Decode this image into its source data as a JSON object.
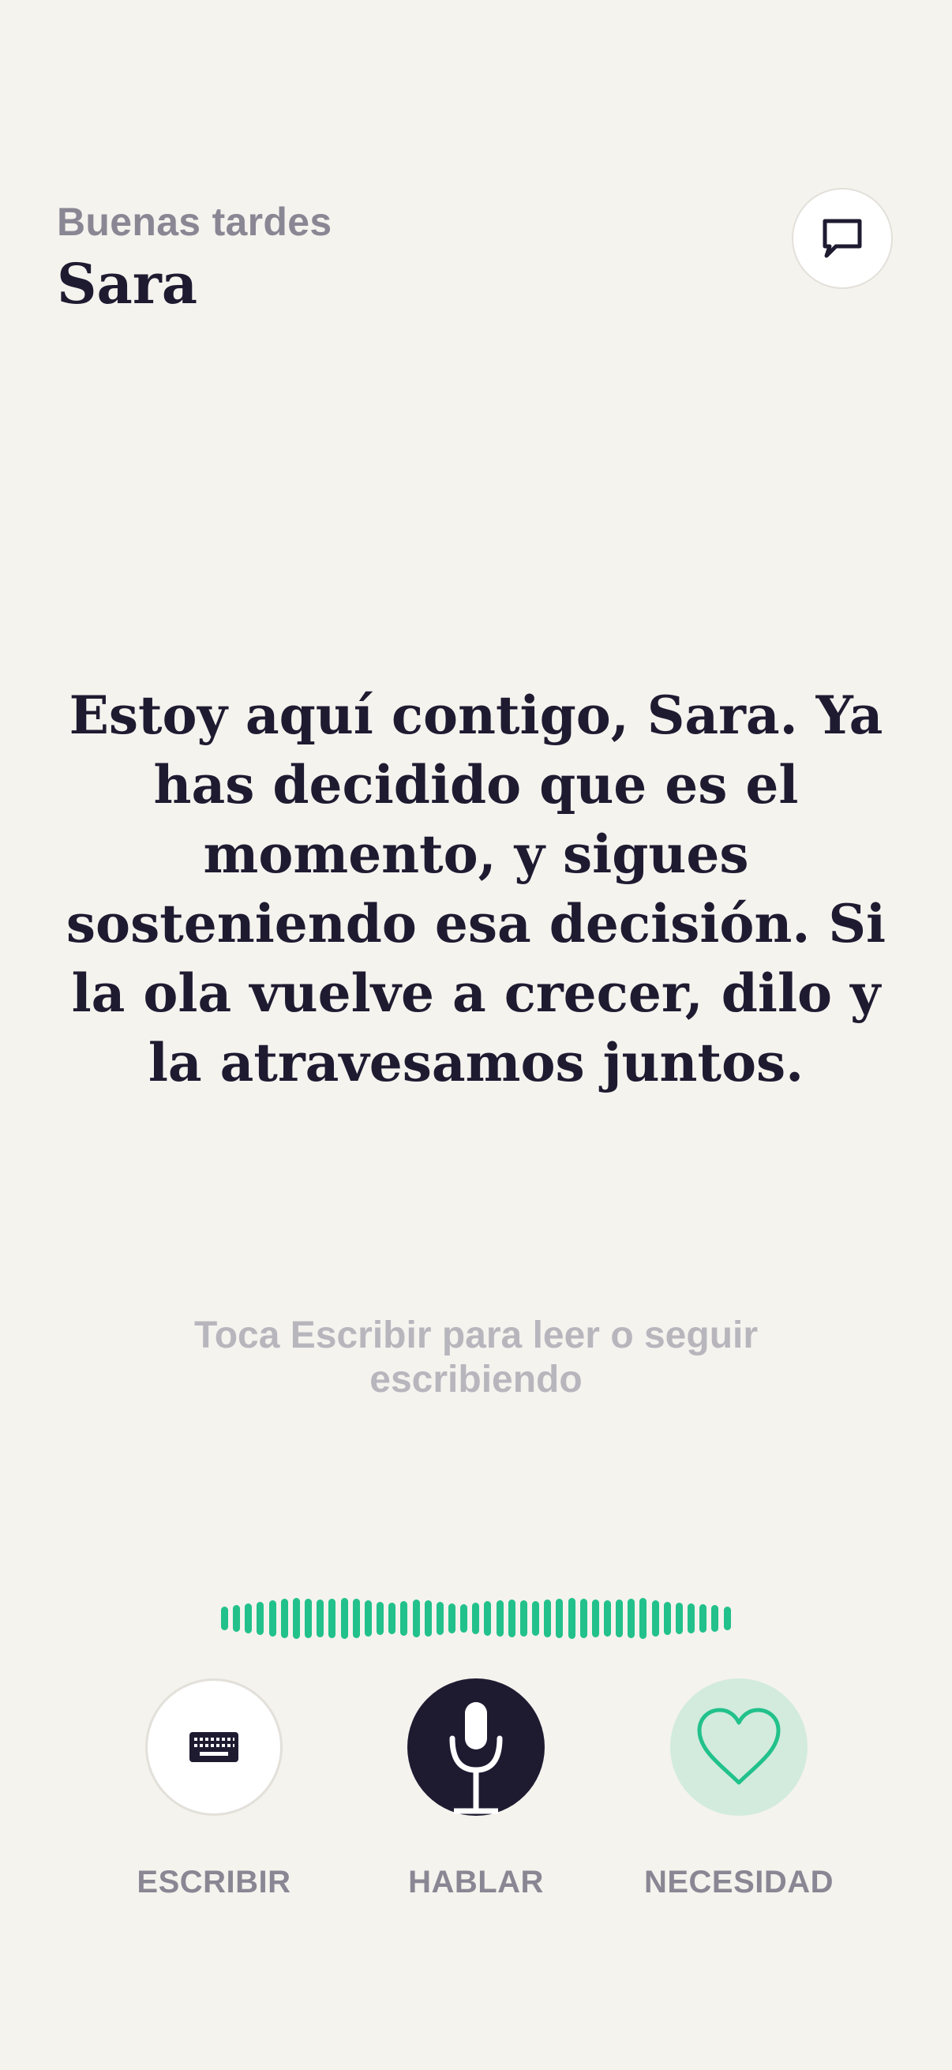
{
  "header": {
    "greeting": "Buenas tardes",
    "name": "Sara",
    "chat_icon": "chat-bubble-icon"
  },
  "main": {
    "message": "Estoy aquí contigo, Sara. Ya has decidido que es el momento, y sigues sosteniendo esa decisión. Si la ola vuelve a crecer, dilo y la atravesamos juntos.",
    "hint": "Toca Escribir para leer o seguir escribiendo"
  },
  "actions": {
    "write": {
      "label": "ESCRIBIR",
      "icon": "keyboard-icon"
    },
    "talk": {
      "label": "HABLAR",
      "icon": "microphone-icon"
    },
    "need": {
      "label": "NECESIDAD",
      "icon": "heart-icon"
    }
  },
  "colors": {
    "background": "#f5f3ee",
    "ink": "#1e1b31",
    "muted": "#8a8794",
    "accent_green": "#22c18b",
    "need_bg": "#d2ebdd"
  }
}
